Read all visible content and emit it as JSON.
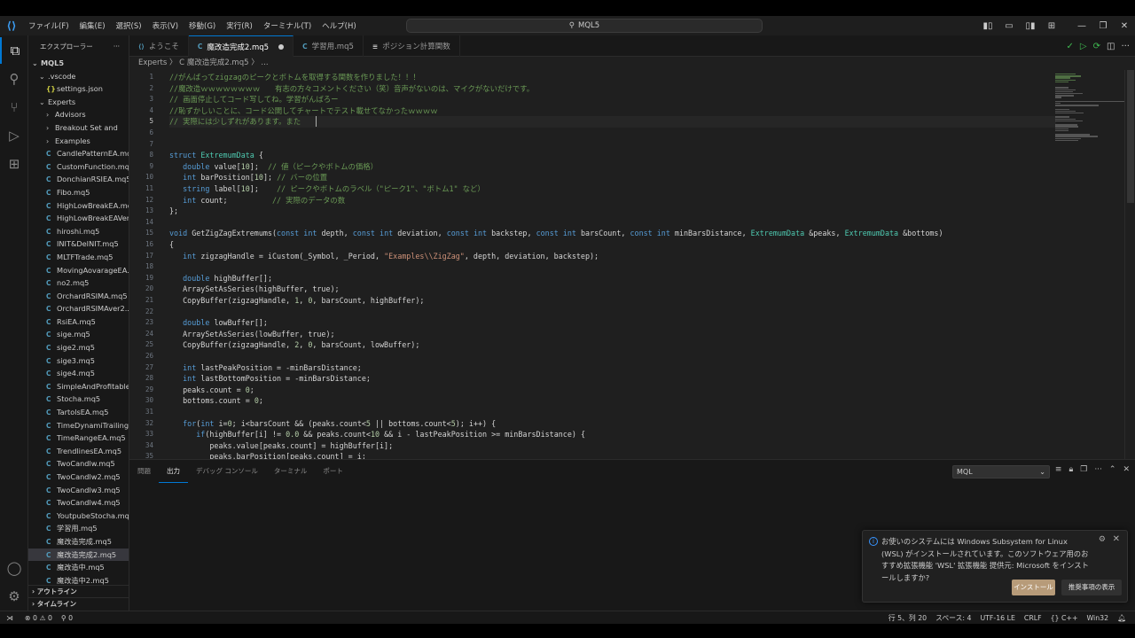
{
  "titlebar": {
    "menu": [
      "ファイル(F)",
      "編集(E)",
      "選択(S)",
      "表示(V)",
      "移動(G)",
      "実行(R)",
      "ターミナル(T)",
      "ヘルプ(H)"
    ],
    "search_text": "MQL5"
  },
  "sidebar": {
    "title": "エクスプローラー",
    "root": "MQL5",
    "rows": [
      {
        "label": ".vscode",
        "indent": 1,
        "type": "folder-open"
      },
      {
        "label": "settings.json",
        "indent": 2,
        "type": "json"
      },
      {
        "label": "Experts",
        "indent": 1,
        "type": "folder-open"
      },
      {
        "label": "Advisors",
        "indent": 2,
        "type": "folder"
      },
      {
        "label": "Breakout Set and",
        "indent": 2,
        "type": "folder"
      },
      {
        "label": "Examples",
        "indent": 2,
        "type": "folder"
      },
      {
        "label": "CandlePatternEA.mq5",
        "indent": 2,
        "type": "file"
      },
      {
        "label": "CustomFunction.mq5",
        "indent": 2,
        "type": "file"
      },
      {
        "label": "DonchianRSIEA.mq5",
        "indent": 2,
        "type": "file"
      },
      {
        "label": "Fibo.mq5",
        "indent": 2,
        "type": "file"
      },
      {
        "label": "HighLowBreakEA.mq5",
        "indent": 2,
        "type": "file"
      },
      {
        "label": "HighLowBreakEAVer...",
        "indent": 2,
        "type": "file"
      },
      {
        "label": "hiroshi.mq5",
        "indent": 2,
        "type": "file"
      },
      {
        "label": "INIT&DeINIT.mq5",
        "indent": 2,
        "type": "file"
      },
      {
        "label": "MLTFTrade.mq5",
        "indent": 2,
        "type": "file"
      },
      {
        "label": "MovingAovarageEA...",
        "indent": 2,
        "type": "file"
      },
      {
        "label": "no2.mq5",
        "indent": 2,
        "type": "file"
      },
      {
        "label": "OrchardRSIMA.mq5",
        "indent": 2,
        "type": "file"
      },
      {
        "label": "OrchardRSIMAver2....",
        "indent": 2,
        "type": "file"
      },
      {
        "label": "RsiEA.mq5",
        "indent": 2,
        "type": "file"
      },
      {
        "label": "sige.mq5",
        "indent": 2,
        "type": "file"
      },
      {
        "label": "sige2.mq5",
        "indent": 2,
        "type": "file"
      },
      {
        "label": "sige3.mq5",
        "indent": 2,
        "type": "file"
      },
      {
        "label": "sige4.mq5",
        "indent": 2,
        "type": "file"
      },
      {
        "label": "SimpleAndProfitable...",
        "indent": 2,
        "type": "file"
      },
      {
        "label": "Stocha.mq5",
        "indent": 2,
        "type": "file"
      },
      {
        "label": "TartolsEA.mq5",
        "indent": 2,
        "type": "file"
      },
      {
        "label": "TimeDynamiTrailing...",
        "indent": 2,
        "type": "file"
      },
      {
        "label": "TimeRangeEA.mq5",
        "indent": 2,
        "type": "file"
      },
      {
        "label": "TrendlinesEA.mq5",
        "indent": 2,
        "type": "file"
      },
      {
        "label": "TwoCandlw.mq5",
        "indent": 2,
        "type": "file"
      },
      {
        "label": "TwoCandlw2.mq5",
        "indent": 2,
        "type": "file"
      },
      {
        "label": "TwoCandlw3.mq5",
        "indent": 2,
        "type": "file"
      },
      {
        "label": "TwoCandlw4.mq5",
        "indent": 2,
        "type": "file"
      },
      {
        "label": "YoutpubeStocha.mq5",
        "indent": 2,
        "type": "file"
      },
      {
        "label": "学習用.mq5",
        "indent": 2,
        "type": "file"
      },
      {
        "label": "魔改造完成.mq5",
        "indent": 2,
        "type": "file"
      },
      {
        "label": "魔改造完成2.mq5",
        "indent": 2,
        "type": "file",
        "selected": true
      },
      {
        "label": "魔改造中.mq5",
        "indent": 2,
        "type": "file"
      },
      {
        "label": "魔改造中2.mq5",
        "indent": 2,
        "type": "file"
      }
    ],
    "outline": "アウトライン",
    "timeline": "タイムライン"
  },
  "tabs": [
    {
      "label": "ようこそ",
      "icon": "vscode-icon",
      "active": false
    },
    {
      "label": "魔改造完成2.mq5",
      "icon": "c-file-icon",
      "active": true,
      "dirty": true
    },
    {
      "label": "学習用.mq5",
      "icon": "c-file-icon",
      "active": false
    },
    {
      "label": "ポジション計算関数",
      "icon": "document-icon",
      "active": false
    }
  ],
  "breadcrumb": "Experts 〉 C 魔改造完成2.mq5 〉 ...",
  "editor": {
    "lines": [
      {
        "n": "1",
        "t": "//がんばってzigzagのピークとボトムを取得する関数を作りました！！！",
        "c": "cm"
      },
      {
        "n": "2",
        "t": "//魔改造ｗｗｗｗｗｗｗｗ　　有志の方々コメントください（笑）音声がないのは、マイクがないだけです。",
        "c": "cm"
      },
      {
        "n": "3",
        "t": "// 画面停止してコード写してね。学習がんばろー",
        "c": "cm"
      },
      {
        "n": "4",
        "t": "//恥ずかしいことに、コード公開してチャートでテスト載せてなかったｗｗｗｗ",
        "c": "cm"
      },
      {
        "n": "5",
        "t": "// 実際には少しずれがあります。また",
        "c": "cm",
        "current": true
      },
      {
        "n": "6",
        "t": "",
        "c": ""
      },
      {
        "n": "7",
        "t": "",
        "c": ""
      },
      {
        "n": "8",
        "t": "struct ExtremumData {",
        "c": ""
      },
      {
        "n": "9",
        "t": "   double value[10];  // 値（ピークやボトムの価格）",
        "c": ""
      },
      {
        "n": "10",
        "t": "   int barPosition[10]; // バーの位置",
        "c": ""
      },
      {
        "n": "11",
        "t": "   string label[10];    // ピークやボトムのラベル（\"ピーク1\"、\"ボトム1\" など）",
        "c": ""
      },
      {
        "n": "12",
        "t": "   int count;          // 実際のデータの数",
        "c": ""
      },
      {
        "n": "13",
        "t": "};",
        "c": ""
      },
      {
        "n": "14",
        "t": "",
        "c": ""
      },
      {
        "n": "15",
        "t": "void GetZigZagExtremums(const int depth, const int deviation, const int backstep, const int barsCount, const int minBarsDistance, ExtremumData &peaks, ExtremumData &bottoms)",
        "c": ""
      },
      {
        "n": "16",
        "t": "{",
        "c": ""
      },
      {
        "n": "17",
        "t": "   int zigzagHandle = iCustom(_Symbol, _Period, \"Examples\\\\ZigZag\", depth, deviation, backstep);",
        "c": ""
      },
      {
        "n": "18",
        "t": "",
        "c": ""
      },
      {
        "n": "19",
        "t": "   double highBuffer[];",
        "c": ""
      },
      {
        "n": "20",
        "t": "   ArraySetAsSeries(highBuffer, true);",
        "c": ""
      },
      {
        "n": "21",
        "t": "   CopyBuffer(zigzagHandle, 1, 0, barsCount, highBuffer);",
        "c": ""
      },
      {
        "n": "22",
        "t": "",
        "c": ""
      },
      {
        "n": "23",
        "t": "   double lowBuffer[];",
        "c": ""
      },
      {
        "n": "24",
        "t": "   ArraySetAsSeries(lowBuffer, true);",
        "c": ""
      },
      {
        "n": "25",
        "t": "   CopyBuffer(zigzagHandle, 2, 0, barsCount, lowBuffer);",
        "c": ""
      },
      {
        "n": "26",
        "t": "",
        "c": ""
      },
      {
        "n": "27",
        "t": "   int lastPeakPosition = -minBarsDistance;",
        "c": ""
      },
      {
        "n": "28",
        "t": "   int lastBottomPosition = -minBarsDistance;",
        "c": ""
      },
      {
        "n": "29",
        "t": "   peaks.count = 0;",
        "c": ""
      },
      {
        "n": "30",
        "t": "   bottoms.count = 0;",
        "c": ""
      },
      {
        "n": "31",
        "t": "",
        "c": ""
      },
      {
        "n": "32",
        "t": "   for(int i=0; i<barsCount && (peaks.count<5 || bottoms.count<5); i++) {",
        "c": ""
      },
      {
        "n": "33",
        "t": "      if(highBuffer[i] != 0.0 && peaks.count<10 && i - lastPeakPosition >= minBarsDistance) {",
        "c": ""
      },
      {
        "n": "34",
        "t": "         peaks.value[peaks.count] = highBuffer[i];",
        "c": ""
      },
      {
        "n": "35",
        "t": "         peaks.barPosition[peaks.count] = i;",
        "c": ""
      }
    ]
  },
  "panel": {
    "tabs": [
      "問題",
      "出力",
      "デバッグ コンソール",
      "ターミナル",
      "ポート"
    ],
    "active_tab": "出力",
    "channel": "MQL"
  },
  "notification": {
    "message": "お使いのシステムには Windows Subsystem for Linux (WSL) がインストールされています。このソフトウェア用のおすすめ拡張機能 'WSL' 拡張機能 提供元: Microsoft をインストールしますか?",
    "install_label": "インストール",
    "show_recommendations_label": "推奨事項の表示"
  },
  "statusbar": {
    "errors": "0",
    "warnings": "0",
    "ports": "0",
    "position": "行 5、列 20",
    "spaces": "スペース: 4",
    "encoding": "UTF-16 LE",
    "eol": "CRLF",
    "language": "C++",
    "platform": "Win32"
  }
}
